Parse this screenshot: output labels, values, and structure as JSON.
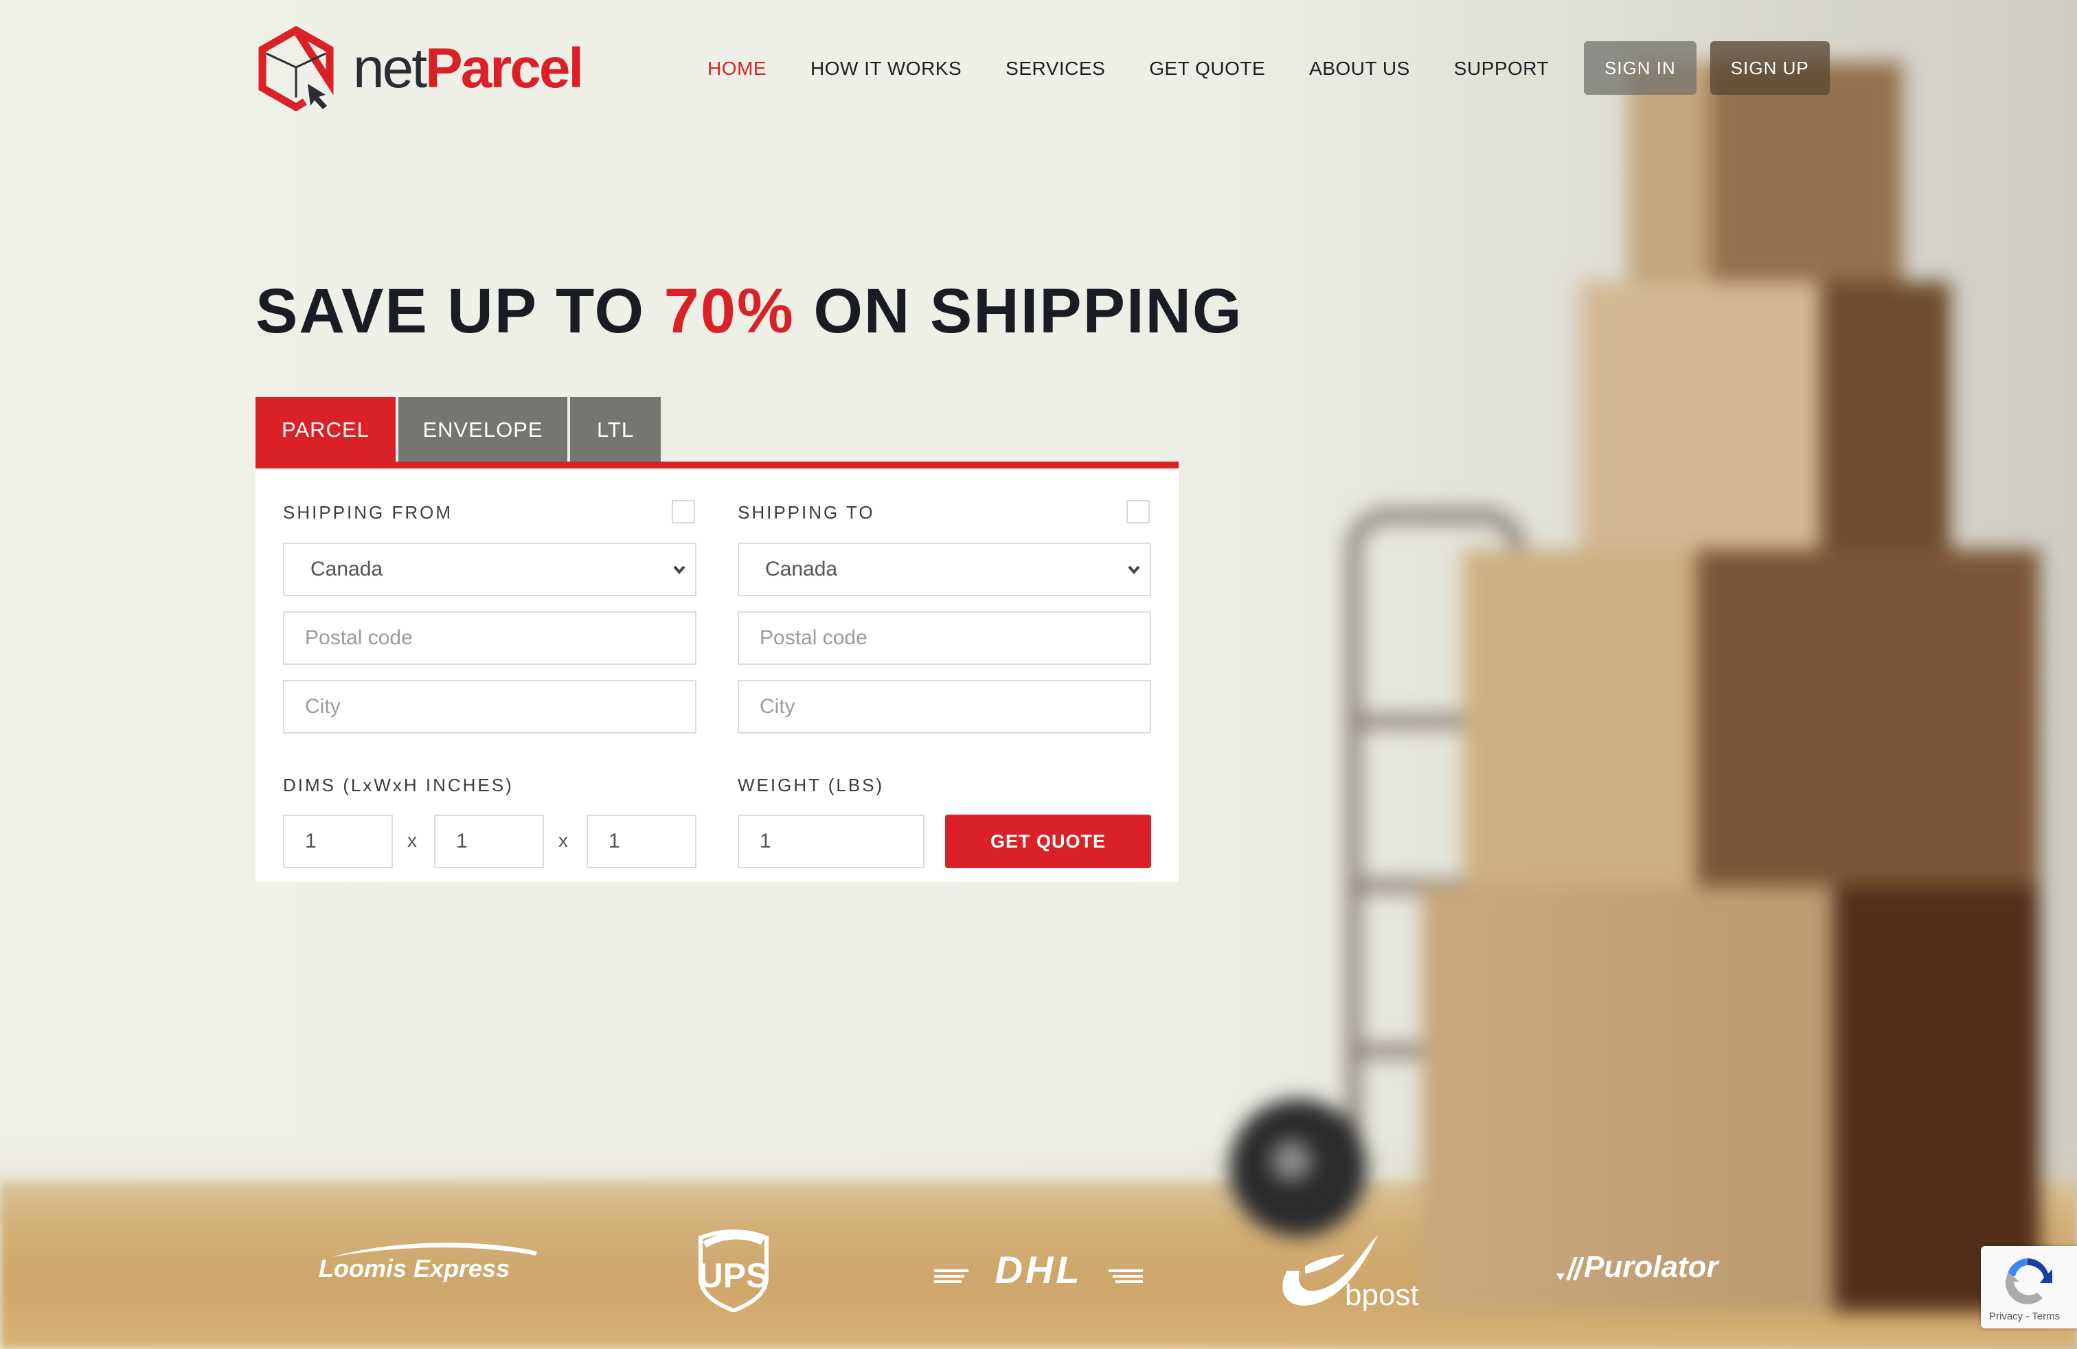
{
  "brand": {
    "name_prefix": "net",
    "name_suffix": "Parcel",
    "accent_color": "#db2128",
    "dark_color": "#2a2d34"
  },
  "nav": {
    "items": [
      {
        "label": "HOME",
        "active": true
      },
      {
        "label": "HOW IT WORKS",
        "active": false
      },
      {
        "label": "SERVICES",
        "active": false
      },
      {
        "label": "GET QUOTE",
        "active": false
      },
      {
        "label": "ABOUT US",
        "active": false
      },
      {
        "label": "SUPPORT",
        "active": false
      }
    ],
    "sign_in": "SIGN IN",
    "sign_up": "SIGN UP"
  },
  "hero": {
    "headline_pre": "SAVE UP TO ",
    "headline_accent": "70%",
    "headline_post": " ON SHIPPING"
  },
  "quote_form": {
    "tabs": [
      {
        "label": "PARCEL",
        "active": true
      },
      {
        "label": "ENVELOPE",
        "active": false
      },
      {
        "label": "LTL",
        "active": false
      }
    ],
    "from": {
      "label": "SHIPPING FROM",
      "checkbox_checked": false,
      "country": "Canada",
      "postal_placeholder": "Postal code",
      "city_placeholder": "City"
    },
    "to": {
      "label": "SHIPPING TO",
      "checkbox_checked": false,
      "country": "Canada",
      "postal_placeholder": "Postal code",
      "city_placeholder": "City"
    },
    "dims": {
      "label": "DIMS (LxWxH INCHES)",
      "length": "1",
      "width": "1",
      "height": "1",
      "separator": "x"
    },
    "weight": {
      "label": "WEIGHT (LBS)",
      "value": "1"
    },
    "submit_label": "GET QUOTE"
  },
  "carriers": [
    {
      "name": "Loomis Express",
      "icon": "loomis-express-logo"
    },
    {
      "name": "UPS",
      "icon": "ups-logo"
    },
    {
      "name": "DHL",
      "icon": "dhl-logo"
    },
    {
      "name": "bpost",
      "icon": "bpost-logo"
    },
    {
      "name": "Purolator",
      "icon": "purolator-logo"
    }
  ],
  "recaptcha": {
    "links": "Privacy - Terms",
    "icon": "recaptcha-icon"
  }
}
